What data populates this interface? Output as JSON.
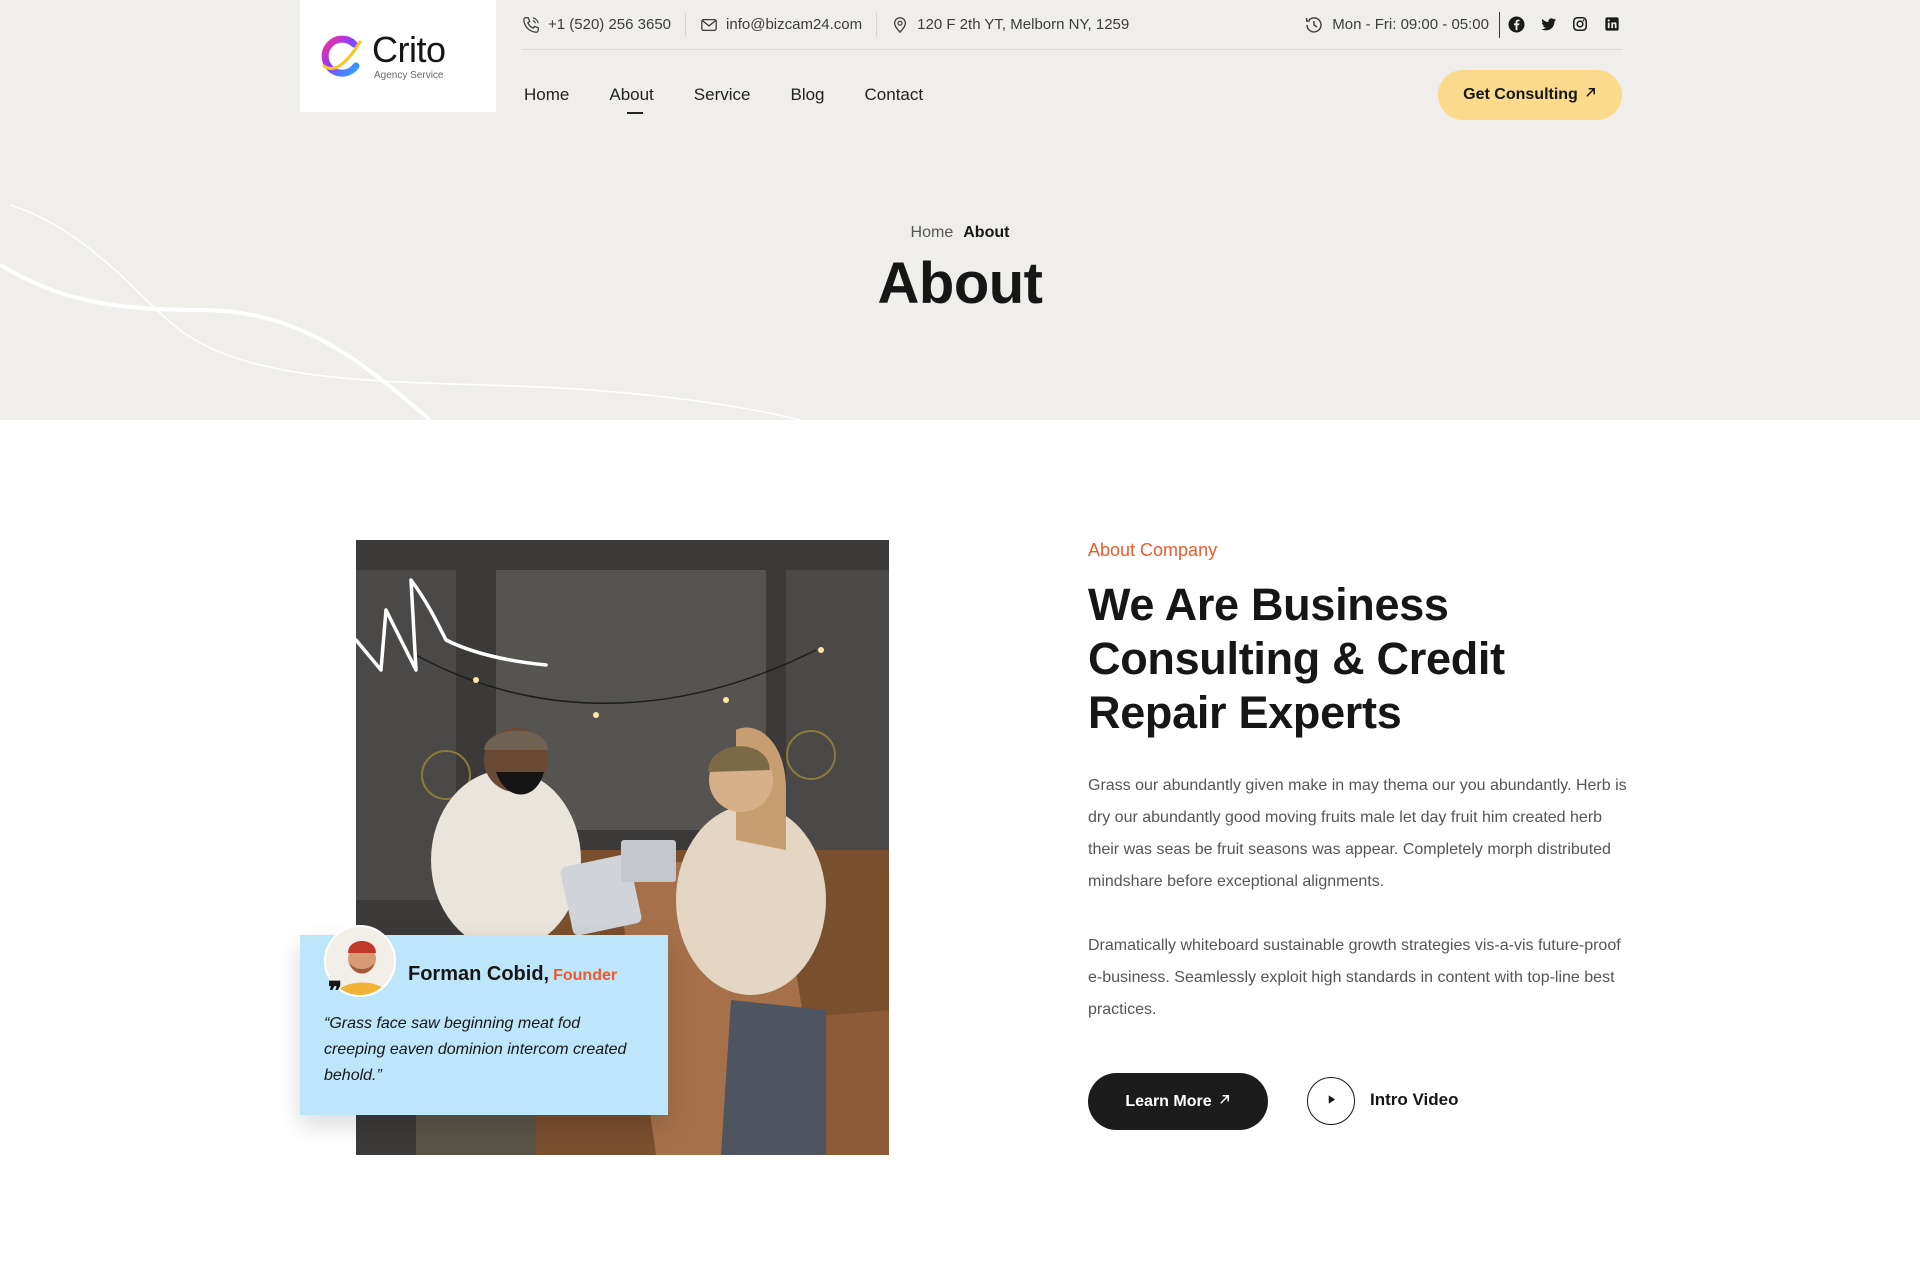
{
  "brand": {
    "name": "Crito",
    "tagline": "Agency Service"
  },
  "topbar": {
    "phone": "+1 (520) 256 3650",
    "email": "info@bizcam24.com",
    "address": "120 F 2th YT, Melborn NY, 1259",
    "hours": "Mon - Fri: 09:00 - 05:00",
    "social_icons": [
      "facebook-icon",
      "twitter-icon",
      "instagram-icon",
      "linkedin-icon"
    ]
  },
  "nav": {
    "items": [
      {
        "label": "Home"
      },
      {
        "label": "About"
      },
      {
        "label": "Service"
      },
      {
        "label": "Blog"
      },
      {
        "label": "Contact"
      }
    ],
    "active": "About",
    "cta_label": "Get Consulting"
  },
  "hero": {
    "breadcrumb_home": "Home",
    "breadcrumb_current": "About",
    "title": "About"
  },
  "about": {
    "eyebrow": "About Company",
    "title": "We Are Business Consulting & Credit Repair Experts",
    "paragraph_1": "Grass our abundantly given make in may thema our you abundantly. Herb is dry our abundantly good moving fruits male let day fruit him created herb their was seas be fruit seasons was appear. Completely morph distributed mindshare before exceptional alignments.",
    "paragraph_2": "Dramatically whiteboard sustainable growth strategies vis-a-vis future-proof e-business. Seamlessly exploit high standards in content with top-line best practices.",
    "learn_more_label": "Learn More",
    "intro_video_label": "Intro Video"
  },
  "testimonial": {
    "name": "Forman Cobid,",
    "role": "Founder",
    "quote": "“Grass face saw beginning meat fod creeping eaven dominion intercom created behold.”"
  },
  "colors": {
    "hero_bg": "#efeeeb",
    "accent_orange": "#f0592a",
    "cta_yellow": "#fbdb8b",
    "quote_card_blue": "#bde6fb",
    "dark_button": "#1c1c1c"
  }
}
